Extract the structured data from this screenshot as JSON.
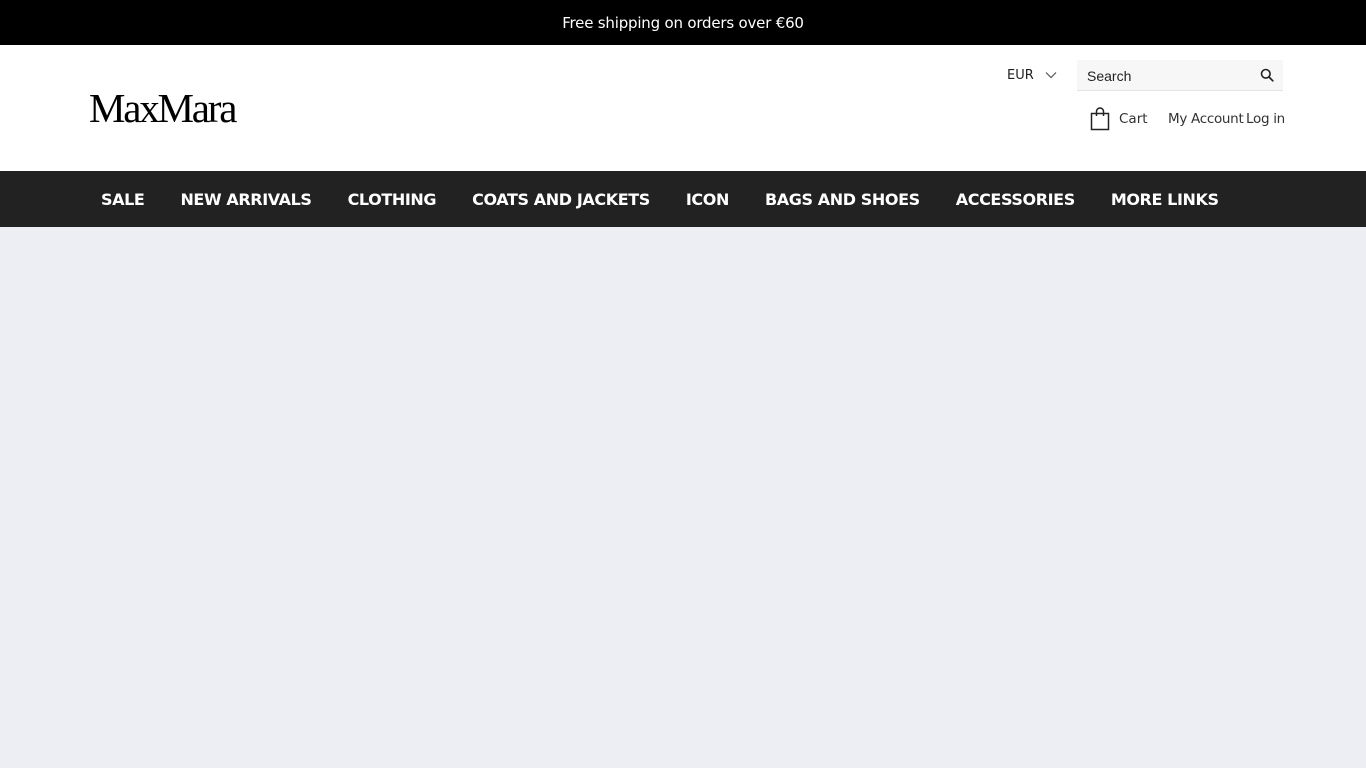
{
  "announcement": {
    "text": "Free shipping on orders over €60"
  },
  "header": {
    "logo_text": "MaxMara",
    "currency": {
      "selected": "EUR",
      "icon": "chevron-down-icon"
    },
    "search": {
      "placeholder": "Search",
      "value": "",
      "icon": "search-icon"
    },
    "cart": {
      "label": "Cart",
      "icon": "shopping-bag-icon"
    },
    "account_label": "My Account",
    "login_label": "Log in"
  },
  "nav": {
    "items": [
      {
        "label": "SALE"
      },
      {
        "label": "NEW ARRIVALS"
      },
      {
        "label": "CLOTHING"
      },
      {
        "label": "COATS AND JACKETS"
      },
      {
        "label": "ICON"
      },
      {
        "label": "BAGS AND SHOES"
      },
      {
        "label": "ACCESSORIES"
      },
      {
        "label": "MORE LINKS"
      }
    ]
  },
  "colors": {
    "announcement_bg": "#000000",
    "nav_bg": "#222222",
    "page_bg": "#edeef3",
    "text_dark": "#222222"
  }
}
